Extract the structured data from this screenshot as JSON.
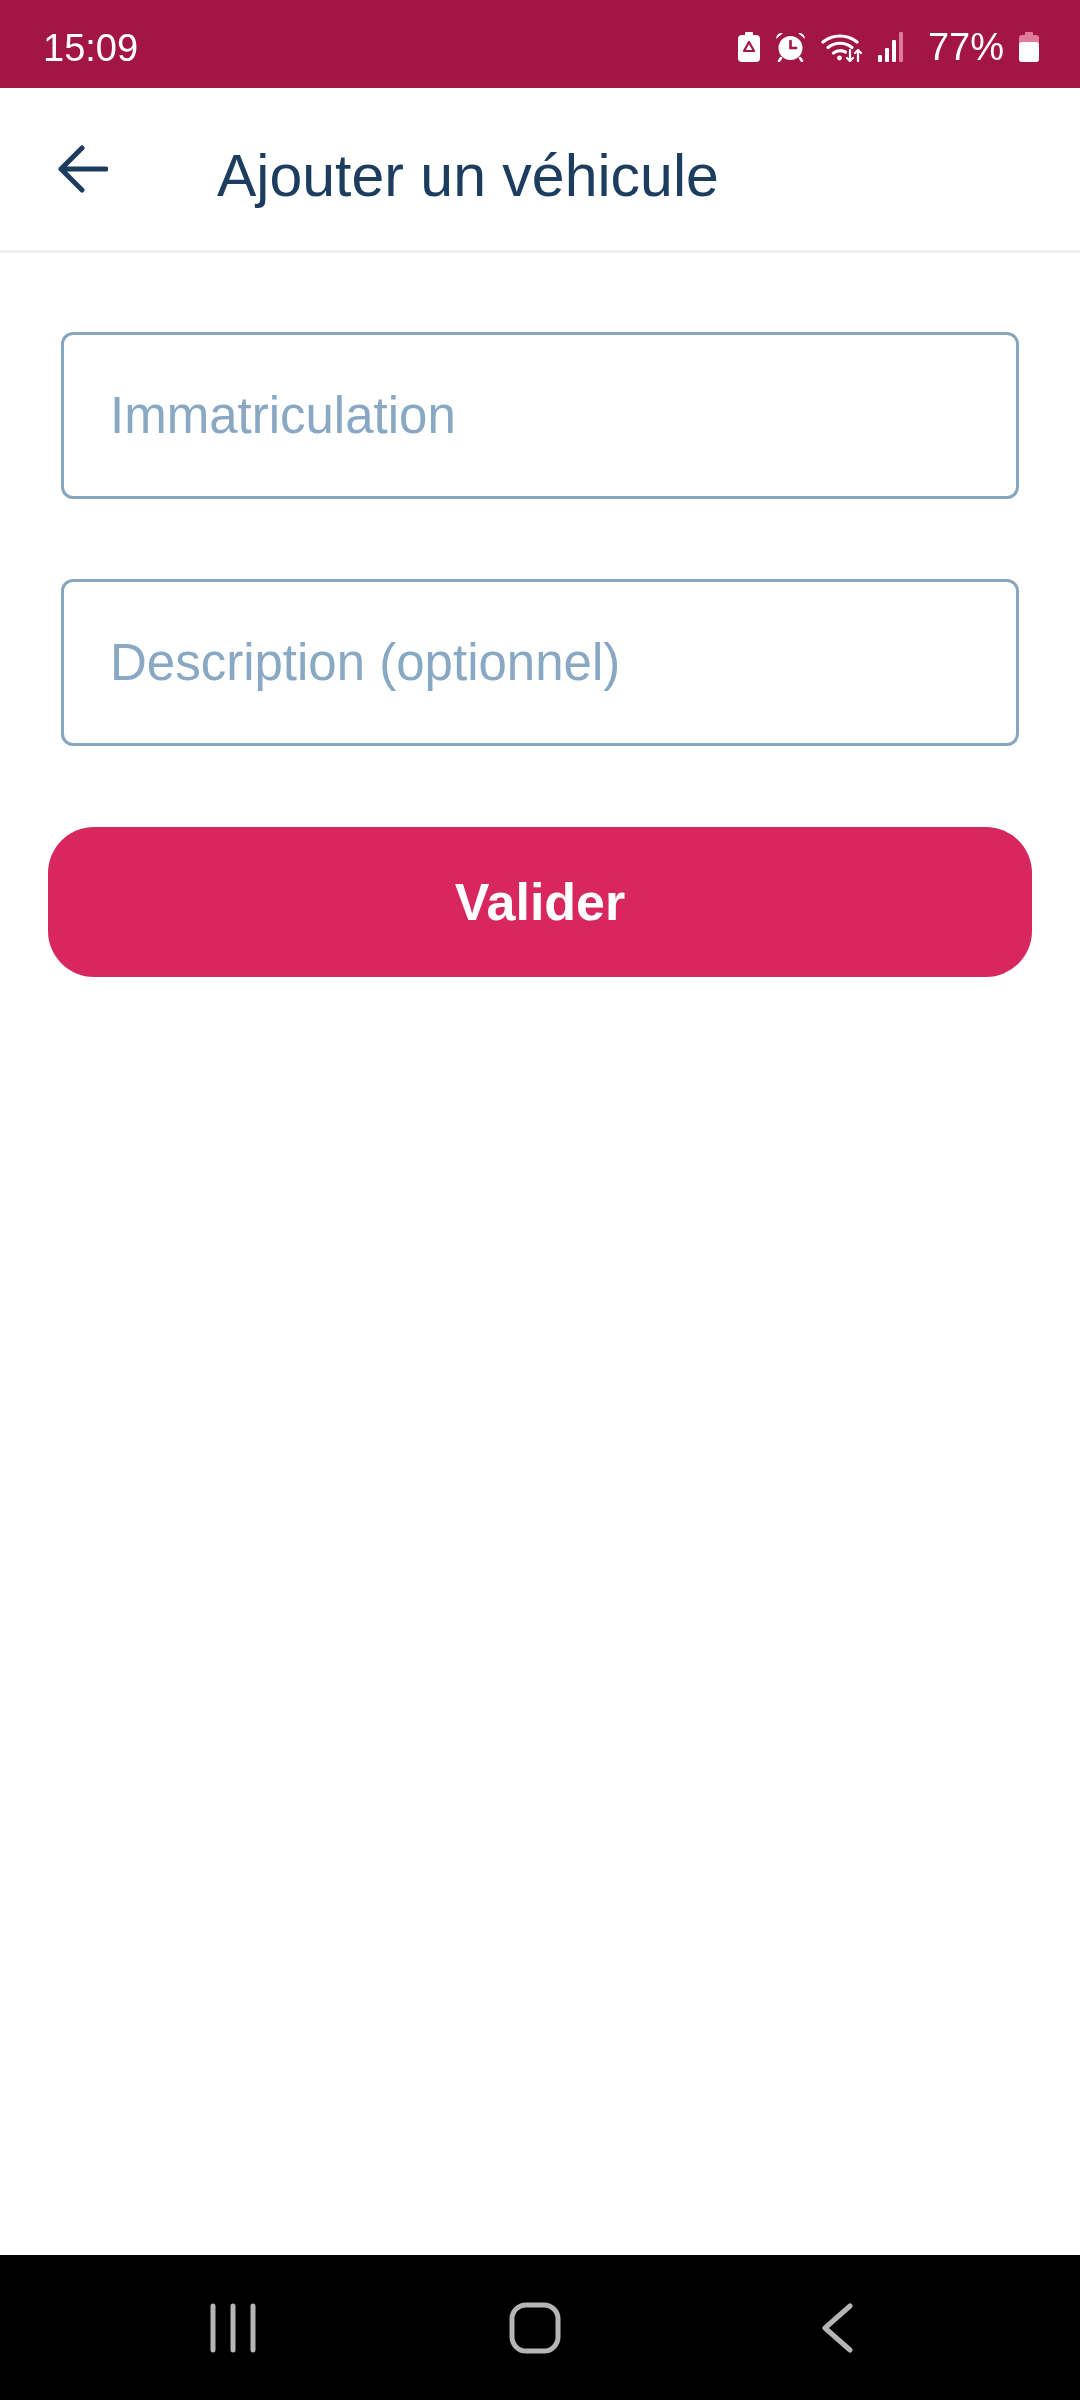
{
  "status_bar": {
    "time": "15:09",
    "battery": "77%"
  },
  "header": {
    "title": "Ajouter un véhicule"
  },
  "form": {
    "fields": [
      {
        "placeholder": "Immatriculation"
      },
      {
        "placeholder": "Description (optionnel)"
      }
    ],
    "submit": {
      "label": "Valider"
    }
  }
}
